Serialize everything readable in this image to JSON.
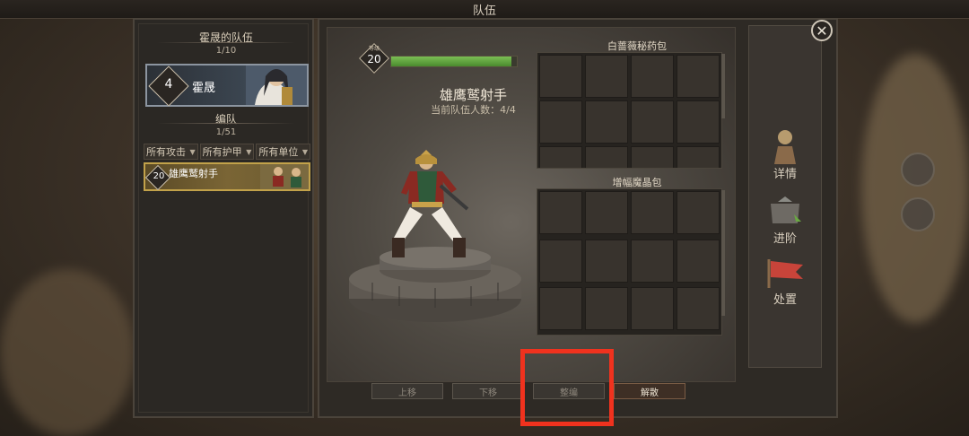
{
  "window": {
    "title": "队伍",
    "close_icon": "close-icon"
  },
  "team_panel": {
    "title": "霍晟的队伍",
    "count": "1/10",
    "hero": {
      "level": "4",
      "name": "霍晟"
    },
    "formation_title": "编队",
    "formation_count": "1/51",
    "filters": [
      "所有攻击",
      "所有护甲",
      "所有单位"
    ],
    "unit_card": {
      "level": "20",
      "name": "雄鹰鹫射手"
    }
  },
  "unit": {
    "level_tag": "等级",
    "level": "20",
    "exp_fraction": 0.96,
    "name": "雄鹰鹫射手",
    "team_count": "当前队伍人数：4/4"
  },
  "bags": [
    {
      "title": "白蔷薇秘药包"
    },
    {
      "title": "增幅魔晶包"
    }
  ],
  "actions": [
    "上移",
    "下移",
    "整编",
    "解散"
  ],
  "side_menu": [
    "详情",
    "进阶",
    "处置"
  ],
  "colors": {
    "highlight": "#f0321e",
    "unit_card_border": "#c2a24a",
    "exp": "#6aa843"
  }
}
